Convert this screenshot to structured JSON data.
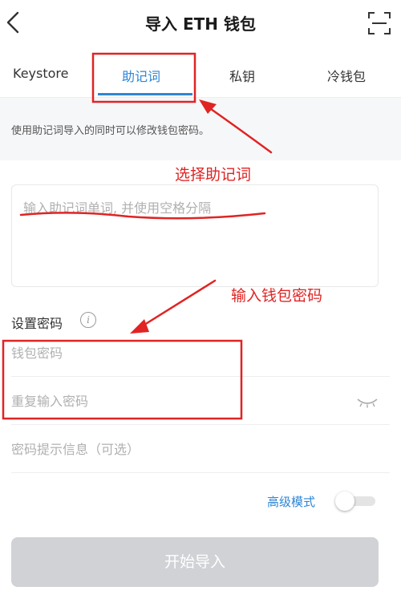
{
  "header": {
    "title": "导入 ETH 钱包"
  },
  "tabs": [
    {
      "label": "Keystore"
    },
    {
      "label": "助记词",
      "active": true
    },
    {
      "label": "私钥"
    },
    {
      "label": "冷钱包"
    }
  ],
  "info": {
    "text": "使用助记词导入的同时可以修改钱包密码。"
  },
  "mnemonic": {
    "placeholder": "输入助记词单词, 并使用空格分隔",
    "value": ""
  },
  "password_section": {
    "label": "设置密码",
    "info_icon_glyph": "i"
  },
  "fields": {
    "password_placeholder": "钱包密码",
    "repeat_placeholder": "重复输入密码",
    "hint_placeholder": "密码提示信息（可选）"
  },
  "advanced": {
    "label": "高级模式",
    "enabled": false
  },
  "start_button": {
    "label": "开始导入",
    "enabled": false
  },
  "annotations": {
    "select_mnemonic": "选择助记词",
    "enter_password": "输入钱包密码"
  },
  "colors": {
    "accent": "#2e86d6",
    "annotation": "#e02424",
    "button_disabled": "#d0d2d6",
    "info_band": "#f6f7f9"
  },
  "icons": {
    "back": "chevron-left-icon",
    "scan": "scan-icon",
    "info": "info-icon",
    "eye": "eye-closed-icon"
  }
}
